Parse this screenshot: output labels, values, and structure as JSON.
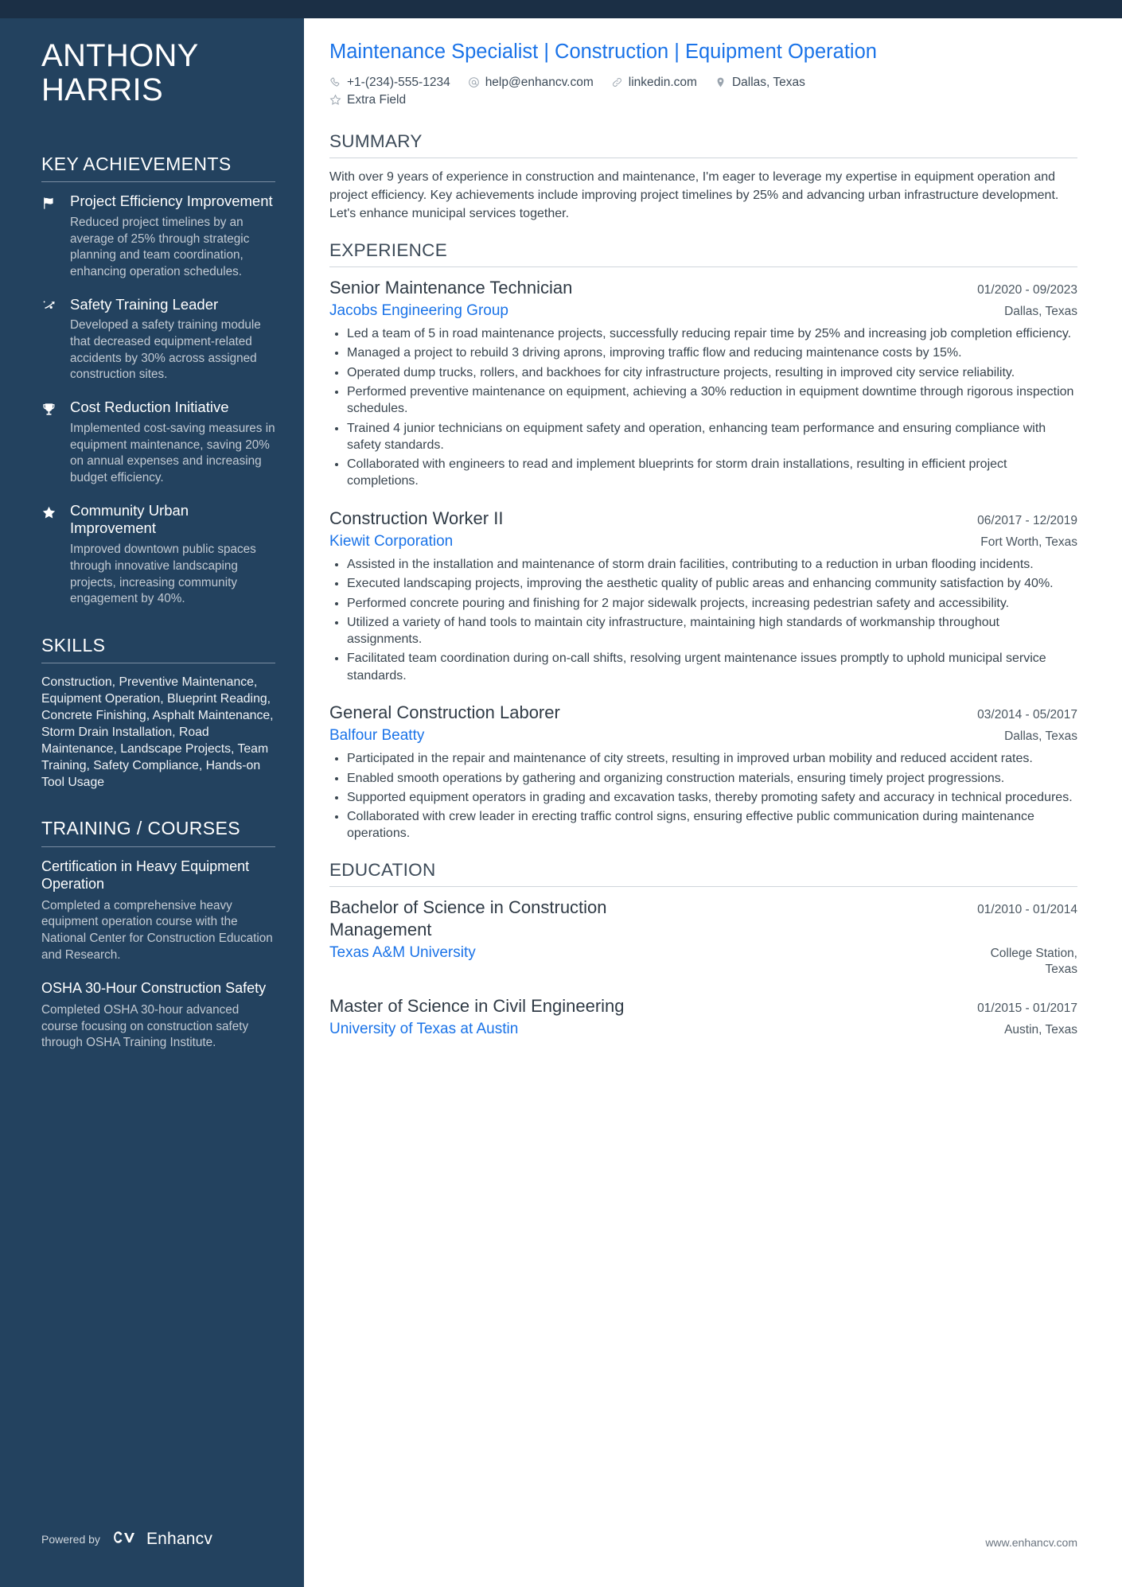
{
  "sidebar": {
    "name_first": "ANTHONY",
    "name_last": "HARRIS",
    "achievements_heading": "KEY ACHIEVEMENTS",
    "achievements": [
      {
        "icon": "flag-icon",
        "title": "Project Efficiency Improvement",
        "description": "Reduced project timelines by an average of 25% through strategic planning and team coordination, enhancing operation schedules."
      },
      {
        "icon": "strategy-arrow-icon",
        "title": "Safety Training Leader",
        "description": "Developed a safety training module that decreased equipment-related accidents by 30% across assigned construction sites."
      },
      {
        "icon": "trophy-icon",
        "title": "Cost Reduction Initiative",
        "description": "Implemented cost-saving measures in equipment maintenance, saving 20% on annual expenses and increasing budget efficiency."
      },
      {
        "icon": "half-star-icon",
        "title": "Community Urban Improvement",
        "description": "Improved downtown public spaces through innovative landscaping projects, increasing community engagement by 40%."
      }
    ],
    "skills_heading": "SKILLS",
    "skills_text": "Construction, Preventive Maintenance, Equipment Operation, Blueprint Reading, Concrete Finishing, Asphalt Maintenance, Storm Drain Installation, Road Maintenance, Landscape Projects, Team Training, Safety Compliance, Hands-on Tool Usage",
    "training_heading": "TRAINING / COURSES",
    "courses": [
      {
        "title": "Certification in Heavy Equipment Operation",
        "description": "Completed a comprehensive heavy equipment operation course with the National Center for Construction Education and Research."
      },
      {
        "title": "OSHA 30-Hour Construction Safety",
        "description": "Completed OSHA 30-hour advanced course focusing on construction safety through OSHA Training Institute."
      }
    ],
    "powered_by": "Powered by",
    "brand": "Enhancv"
  },
  "header": {
    "headline": "Maintenance Specialist | Construction | Equipment Operation",
    "contacts": [
      {
        "icon": "phone-icon",
        "text": "+1-(234)-555-1234"
      },
      {
        "icon": "email-icon",
        "text": "help@enhancv.com"
      },
      {
        "icon": "link-icon",
        "text": "linkedin.com"
      },
      {
        "icon": "location-pin-icon",
        "text": "Dallas, Texas"
      },
      {
        "icon": "star-icon",
        "text": "Extra Field"
      }
    ]
  },
  "summary": {
    "heading": "SUMMARY",
    "text": "With over 9 years of experience in construction and maintenance, I'm eager to leverage my expertise in equipment operation and project efficiency. Key achievements include improving project timelines by 25% and advancing urban infrastructure development. Let's enhance municipal services together."
  },
  "experience": {
    "heading": "EXPERIENCE",
    "entries": [
      {
        "title": "Senior Maintenance Technician",
        "date": "01/2020 - 09/2023",
        "org": "Jacobs Engineering Group",
        "location": "Dallas, Texas",
        "bullets": [
          "Led a team of 5 in road maintenance projects, successfully reducing repair time by 25% and increasing job completion efficiency.",
          "Managed a project to rebuild 3 driving aprons, improving traffic flow and reducing maintenance costs by 15%.",
          "Operated dump trucks, rollers, and backhoes for city infrastructure projects, resulting in improved city service reliability.",
          "Performed preventive maintenance on equipment, achieving a 30% reduction in equipment downtime through rigorous inspection schedules.",
          "Trained 4 junior technicians on equipment safety and operation, enhancing team performance and ensuring compliance with safety standards.",
          "Collaborated with engineers to read and implement blueprints for storm drain installations, resulting in efficient project completions."
        ]
      },
      {
        "title": "Construction Worker II",
        "date": "06/2017 - 12/2019",
        "org": "Kiewit Corporation",
        "location": "Fort Worth, Texas",
        "bullets": [
          "Assisted in the installation and maintenance of storm drain facilities, contributing to a reduction in urban flooding incidents.",
          "Executed landscaping projects, improving the aesthetic quality of public areas and enhancing community satisfaction by 40%.",
          "Performed concrete pouring and finishing for 2 major sidewalk projects, increasing pedestrian safety and accessibility.",
          "Utilized a variety of hand tools to maintain city infrastructure, maintaining high standards of workmanship throughout assignments.",
          "Facilitated team coordination during on-call shifts, resolving urgent maintenance issues promptly to uphold municipal service standards."
        ]
      },
      {
        "title": "General Construction Laborer",
        "date": "03/2014 - 05/2017",
        "org": "Balfour Beatty",
        "location": "Dallas, Texas",
        "bullets": [
          "Participated in the repair and maintenance of city streets, resulting in improved urban mobility and reduced accident rates.",
          "Enabled smooth operations by gathering and organizing construction materials, ensuring timely project progressions.",
          "Supported equipment operators in grading and excavation tasks, thereby promoting safety and accuracy in technical procedures.",
          "Collaborated with crew leader in erecting traffic control signs, ensuring effective public communication during maintenance operations."
        ]
      }
    ]
  },
  "education": {
    "heading": "EDUCATION",
    "entries": [
      {
        "title": "Bachelor of Science in Construction Management",
        "date": "01/2010 - 01/2014",
        "org": "Texas A&M University",
        "location": "College Station, Texas"
      },
      {
        "title": "Master of Science in Civil Engineering",
        "date": "01/2015 - 01/2017",
        "org": "University of Texas at Austin",
        "location": "Austin, Texas"
      }
    ]
  },
  "footer": {
    "website": "www.enhancv.com"
  },
  "colors": {
    "sidebar_bg": "#23425f",
    "top_band": "#1b2f45",
    "accent_blue": "#1a73e8",
    "heading_slate": "#3c4a58"
  }
}
